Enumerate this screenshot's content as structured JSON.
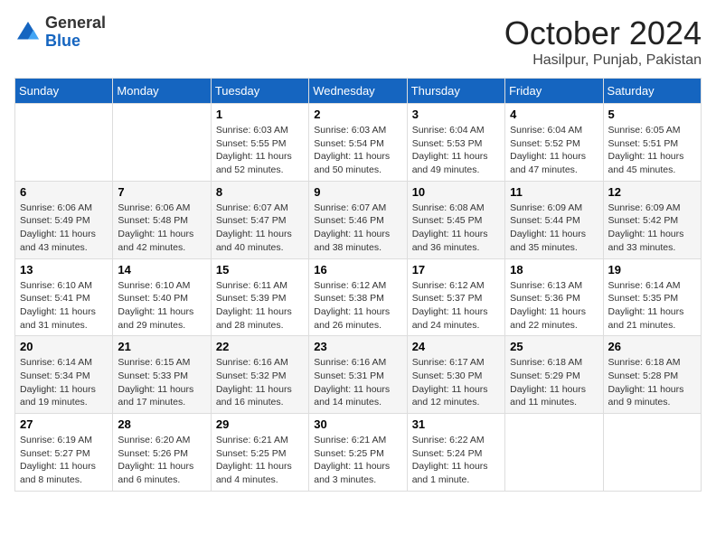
{
  "logo": {
    "general": "General",
    "blue": "Blue"
  },
  "title": "October 2024",
  "location": "Hasilpur, Punjab, Pakistan",
  "weekdays": [
    "Sunday",
    "Monday",
    "Tuesday",
    "Wednesday",
    "Thursday",
    "Friday",
    "Saturday"
  ],
  "weeks": [
    [
      {
        "day": "",
        "sunrise": "",
        "sunset": "",
        "daylight": ""
      },
      {
        "day": "",
        "sunrise": "",
        "sunset": "",
        "daylight": ""
      },
      {
        "day": "1",
        "sunrise": "Sunrise: 6:03 AM",
        "sunset": "Sunset: 5:55 PM",
        "daylight": "Daylight: 11 hours and 52 minutes."
      },
      {
        "day": "2",
        "sunrise": "Sunrise: 6:03 AM",
        "sunset": "Sunset: 5:54 PM",
        "daylight": "Daylight: 11 hours and 50 minutes."
      },
      {
        "day": "3",
        "sunrise": "Sunrise: 6:04 AM",
        "sunset": "Sunset: 5:53 PM",
        "daylight": "Daylight: 11 hours and 49 minutes."
      },
      {
        "day": "4",
        "sunrise": "Sunrise: 6:04 AM",
        "sunset": "Sunset: 5:52 PM",
        "daylight": "Daylight: 11 hours and 47 minutes."
      },
      {
        "day": "5",
        "sunrise": "Sunrise: 6:05 AM",
        "sunset": "Sunset: 5:51 PM",
        "daylight": "Daylight: 11 hours and 45 minutes."
      }
    ],
    [
      {
        "day": "6",
        "sunrise": "Sunrise: 6:06 AM",
        "sunset": "Sunset: 5:49 PM",
        "daylight": "Daylight: 11 hours and 43 minutes."
      },
      {
        "day": "7",
        "sunrise": "Sunrise: 6:06 AM",
        "sunset": "Sunset: 5:48 PM",
        "daylight": "Daylight: 11 hours and 42 minutes."
      },
      {
        "day": "8",
        "sunrise": "Sunrise: 6:07 AM",
        "sunset": "Sunset: 5:47 PM",
        "daylight": "Daylight: 11 hours and 40 minutes."
      },
      {
        "day": "9",
        "sunrise": "Sunrise: 6:07 AM",
        "sunset": "Sunset: 5:46 PM",
        "daylight": "Daylight: 11 hours and 38 minutes."
      },
      {
        "day": "10",
        "sunrise": "Sunrise: 6:08 AM",
        "sunset": "Sunset: 5:45 PM",
        "daylight": "Daylight: 11 hours and 36 minutes."
      },
      {
        "day": "11",
        "sunrise": "Sunrise: 6:09 AM",
        "sunset": "Sunset: 5:44 PM",
        "daylight": "Daylight: 11 hours and 35 minutes."
      },
      {
        "day": "12",
        "sunrise": "Sunrise: 6:09 AM",
        "sunset": "Sunset: 5:42 PM",
        "daylight": "Daylight: 11 hours and 33 minutes."
      }
    ],
    [
      {
        "day": "13",
        "sunrise": "Sunrise: 6:10 AM",
        "sunset": "Sunset: 5:41 PM",
        "daylight": "Daylight: 11 hours and 31 minutes."
      },
      {
        "day": "14",
        "sunrise": "Sunrise: 6:10 AM",
        "sunset": "Sunset: 5:40 PM",
        "daylight": "Daylight: 11 hours and 29 minutes."
      },
      {
        "day": "15",
        "sunrise": "Sunrise: 6:11 AM",
        "sunset": "Sunset: 5:39 PM",
        "daylight": "Daylight: 11 hours and 28 minutes."
      },
      {
        "day": "16",
        "sunrise": "Sunrise: 6:12 AM",
        "sunset": "Sunset: 5:38 PM",
        "daylight": "Daylight: 11 hours and 26 minutes."
      },
      {
        "day": "17",
        "sunrise": "Sunrise: 6:12 AM",
        "sunset": "Sunset: 5:37 PM",
        "daylight": "Daylight: 11 hours and 24 minutes."
      },
      {
        "day": "18",
        "sunrise": "Sunrise: 6:13 AM",
        "sunset": "Sunset: 5:36 PM",
        "daylight": "Daylight: 11 hours and 22 minutes."
      },
      {
        "day": "19",
        "sunrise": "Sunrise: 6:14 AM",
        "sunset": "Sunset: 5:35 PM",
        "daylight": "Daylight: 11 hours and 21 minutes."
      }
    ],
    [
      {
        "day": "20",
        "sunrise": "Sunrise: 6:14 AM",
        "sunset": "Sunset: 5:34 PM",
        "daylight": "Daylight: 11 hours and 19 minutes."
      },
      {
        "day": "21",
        "sunrise": "Sunrise: 6:15 AM",
        "sunset": "Sunset: 5:33 PM",
        "daylight": "Daylight: 11 hours and 17 minutes."
      },
      {
        "day": "22",
        "sunrise": "Sunrise: 6:16 AM",
        "sunset": "Sunset: 5:32 PM",
        "daylight": "Daylight: 11 hours and 16 minutes."
      },
      {
        "day": "23",
        "sunrise": "Sunrise: 6:16 AM",
        "sunset": "Sunset: 5:31 PM",
        "daylight": "Daylight: 11 hours and 14 minutes."
      },
      {
        "day": "24",
        "sunrise": "Sunrise: 6:17 AM",
        "sunset": "Sunset: 5:30 PM",
        "daylight": "Daylight: 11 hours and 12 minutes."
      },
      {
        "day": "25",
        "sunrise": "Sunrise: 6:18 AM",
        "sunset": "Sunset: 5:29 PM",
        "daylight": "Daylight: 11 hours and 11 minutes."
      },
      {
        "day": "26",
        "sunrise": "Sunrise: 6:18 AM",
        "sunset": "Sunset: 5:28 PM",
        "daylight": "Daylight: 11 hours and 9 minutes."
      }
    ],
    [
      {
        "day": "27",
        "sunrise": "Sunrise: 6:19 AM",
        "sunset": "Sunset: 5:27 PM",
        "daylight": "Daylight: 11 hours and 8 minutes."
      },
      {
        "day": "28",
        "sunrise": "Sunrise: 6:20 AM",
        "sunset": "Sunset: 5:26 PM",
        "daylight": "Daylight: 11 hours and 6 minutes."
      },
      {
        "day": "29",
        "sunrise": "Sunrise: 6:21 AM",
        "sunset": "Sunset: 5:25 PM",
        "daylight": "Daylight: 11 hours and 4 minutes."
      },
      {
        "day": "30",
        "sunrise": "Sunrise: 6:21 AM",
        "sunset": "Sunset: 5:25 PM",
        "daylight": "Daylight: 11 hours and 3 minutes."
      },
      {
        "day": "31",
        "sunrise": "Sunrise: 6:22 AM",
        "sunset": "Sunset: 5:24 PM",
        "daylight": "Daylight: 11 hours and 1 minute."
      },
      {
        "day": "",
        "sunrise": "",
        "sunset": "",
        "daylight": ""
      },
      {
        "day": "",
        "sunrise": "",
        "sunset": "",
        "daylight": ""
      }
    ]
  ]
}
